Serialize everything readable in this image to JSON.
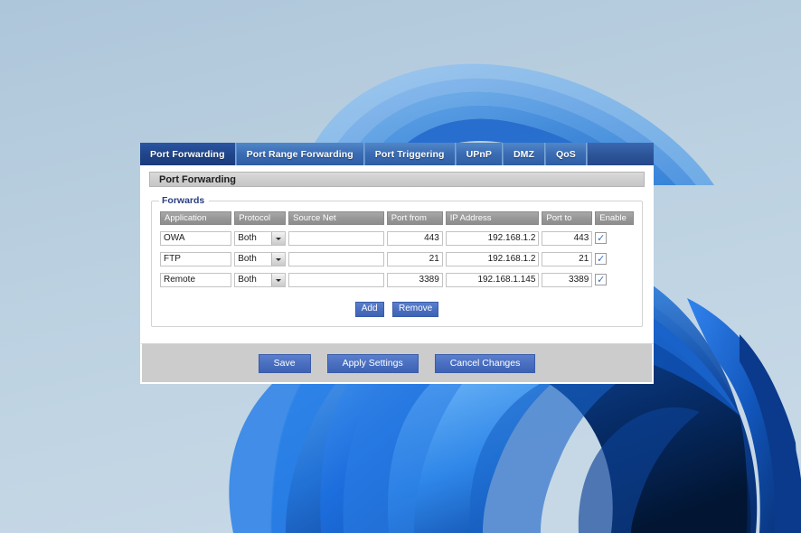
{
  "window": {
    "tabs": [
      {
        "label": "Port Forwarding",
        "active": true
      },
      {
        "label": "Port Range Forwarding",
        "active": false
      },
      {
        "label": "Port Triggering",
        "active": false
      },
      {
        "label": "UPnP",
        "active": false
      },
      {
        "label": "DMZ",
        "active": false
      },
      {
        "label": "QoS",
        "active": false
      }
    ],
    "section_title": "Port Forwarding",
    "fieldset_legend": "Forwards"
  },
  "table": {
    "columns": [
      "Application",
      "Protocol",
      "Source Net",
      "Port from",
      "IP Address",
      "Port to",
      "Enable"
    ],
    "rows": [
      {
        "application": "OWA",
        "protocol": "Both",
        "source_net": "",
        "port_from": "443",
        "ip_address": "192.168.1.2",
        "port_to": "443",
        "enable": true,
        "enable_mark": "✓"
      },
      {
        "application": "FTP",
        "protocol": "Both",
        "source_net": "",
        "port_from": "21",
        "ip_address": "192.168.1.2",
        "port_to": "21",
        "enable": true,
        "enable_mark": "✓"
      },
      {
        "application": "Remote",
        "protocol": "Both",
        "source_net": "",
        "port_from": "3389",
        "ip_address": "192.168.1.145",
        "port_to": "3389",
        "enable": true,
        "enable_mark": "✓"
      }
    ]
  },
  "row_actions": {
    "add_label": "Add",
    "remove_label": "Remove"
  },
  "footer": {
    "save_label": "Save",
    "apply_label": "Apply Settings",
    "cancel_label": "Cancel Changes"
  },
  "colors": {
    "tab_active": "#1f4489",
    "tab_inactive": "#3a6cb4",
    "button_blue": "#4a6fc0",
    "header_gray": "#989898",
    "footer_gray": "#cccccc",
    "legend_text": "#2a3f80",
    "desktop_bg": "#b9cddd"
  }
}
